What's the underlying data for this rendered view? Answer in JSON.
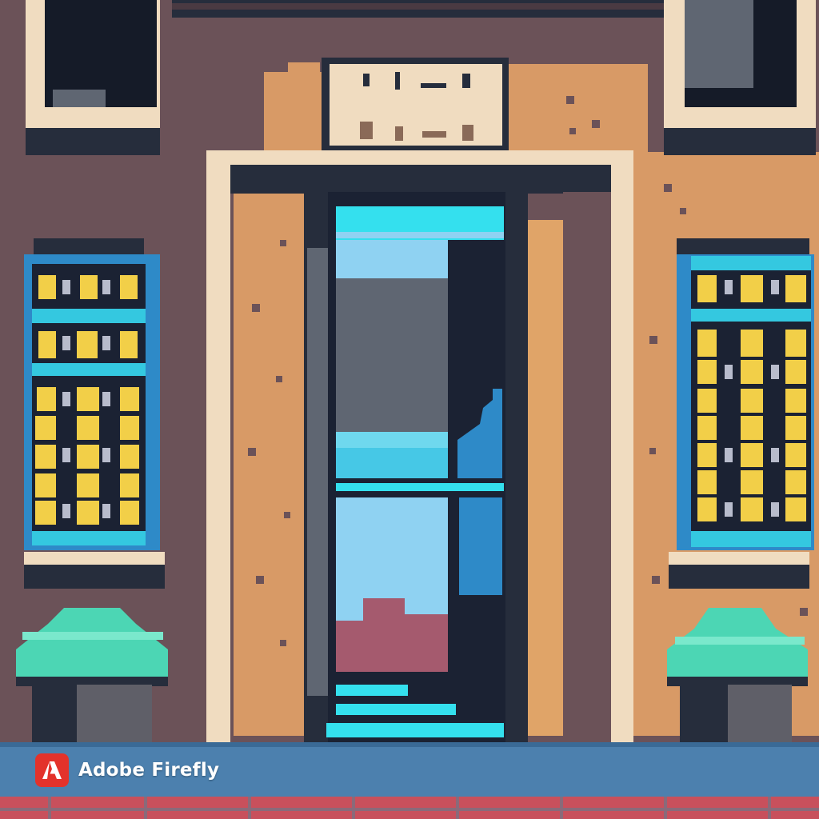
{
  "watermark": {
    "text": "Adobe Firefly",
    "logo_icon": "adobe-firefly-logo-icon",
    "logo_color": "#e3322b"
  },
  "sign_lettering": "",
  "palette": {
    "wall": "#6b5258",
    "stucco": "#d89a66",
    "trim": "#f0dcc0",
    "frame_dark": "#262d3c",
    "glass_cyan": "#34e0ee",
    "glass_light": "#8fd2f2",
    "glass_grey": "#5f6672",
    "shutter_blue": "#2e8ac8",
    "window_yellow": "#f2cf48",
    "plant_teal": "#4cd6b4",
    "pot_grey": "#5f5f68",
    "sidewalk": "#4c80ae",
    "brick": "#c8505c"
  }
}
